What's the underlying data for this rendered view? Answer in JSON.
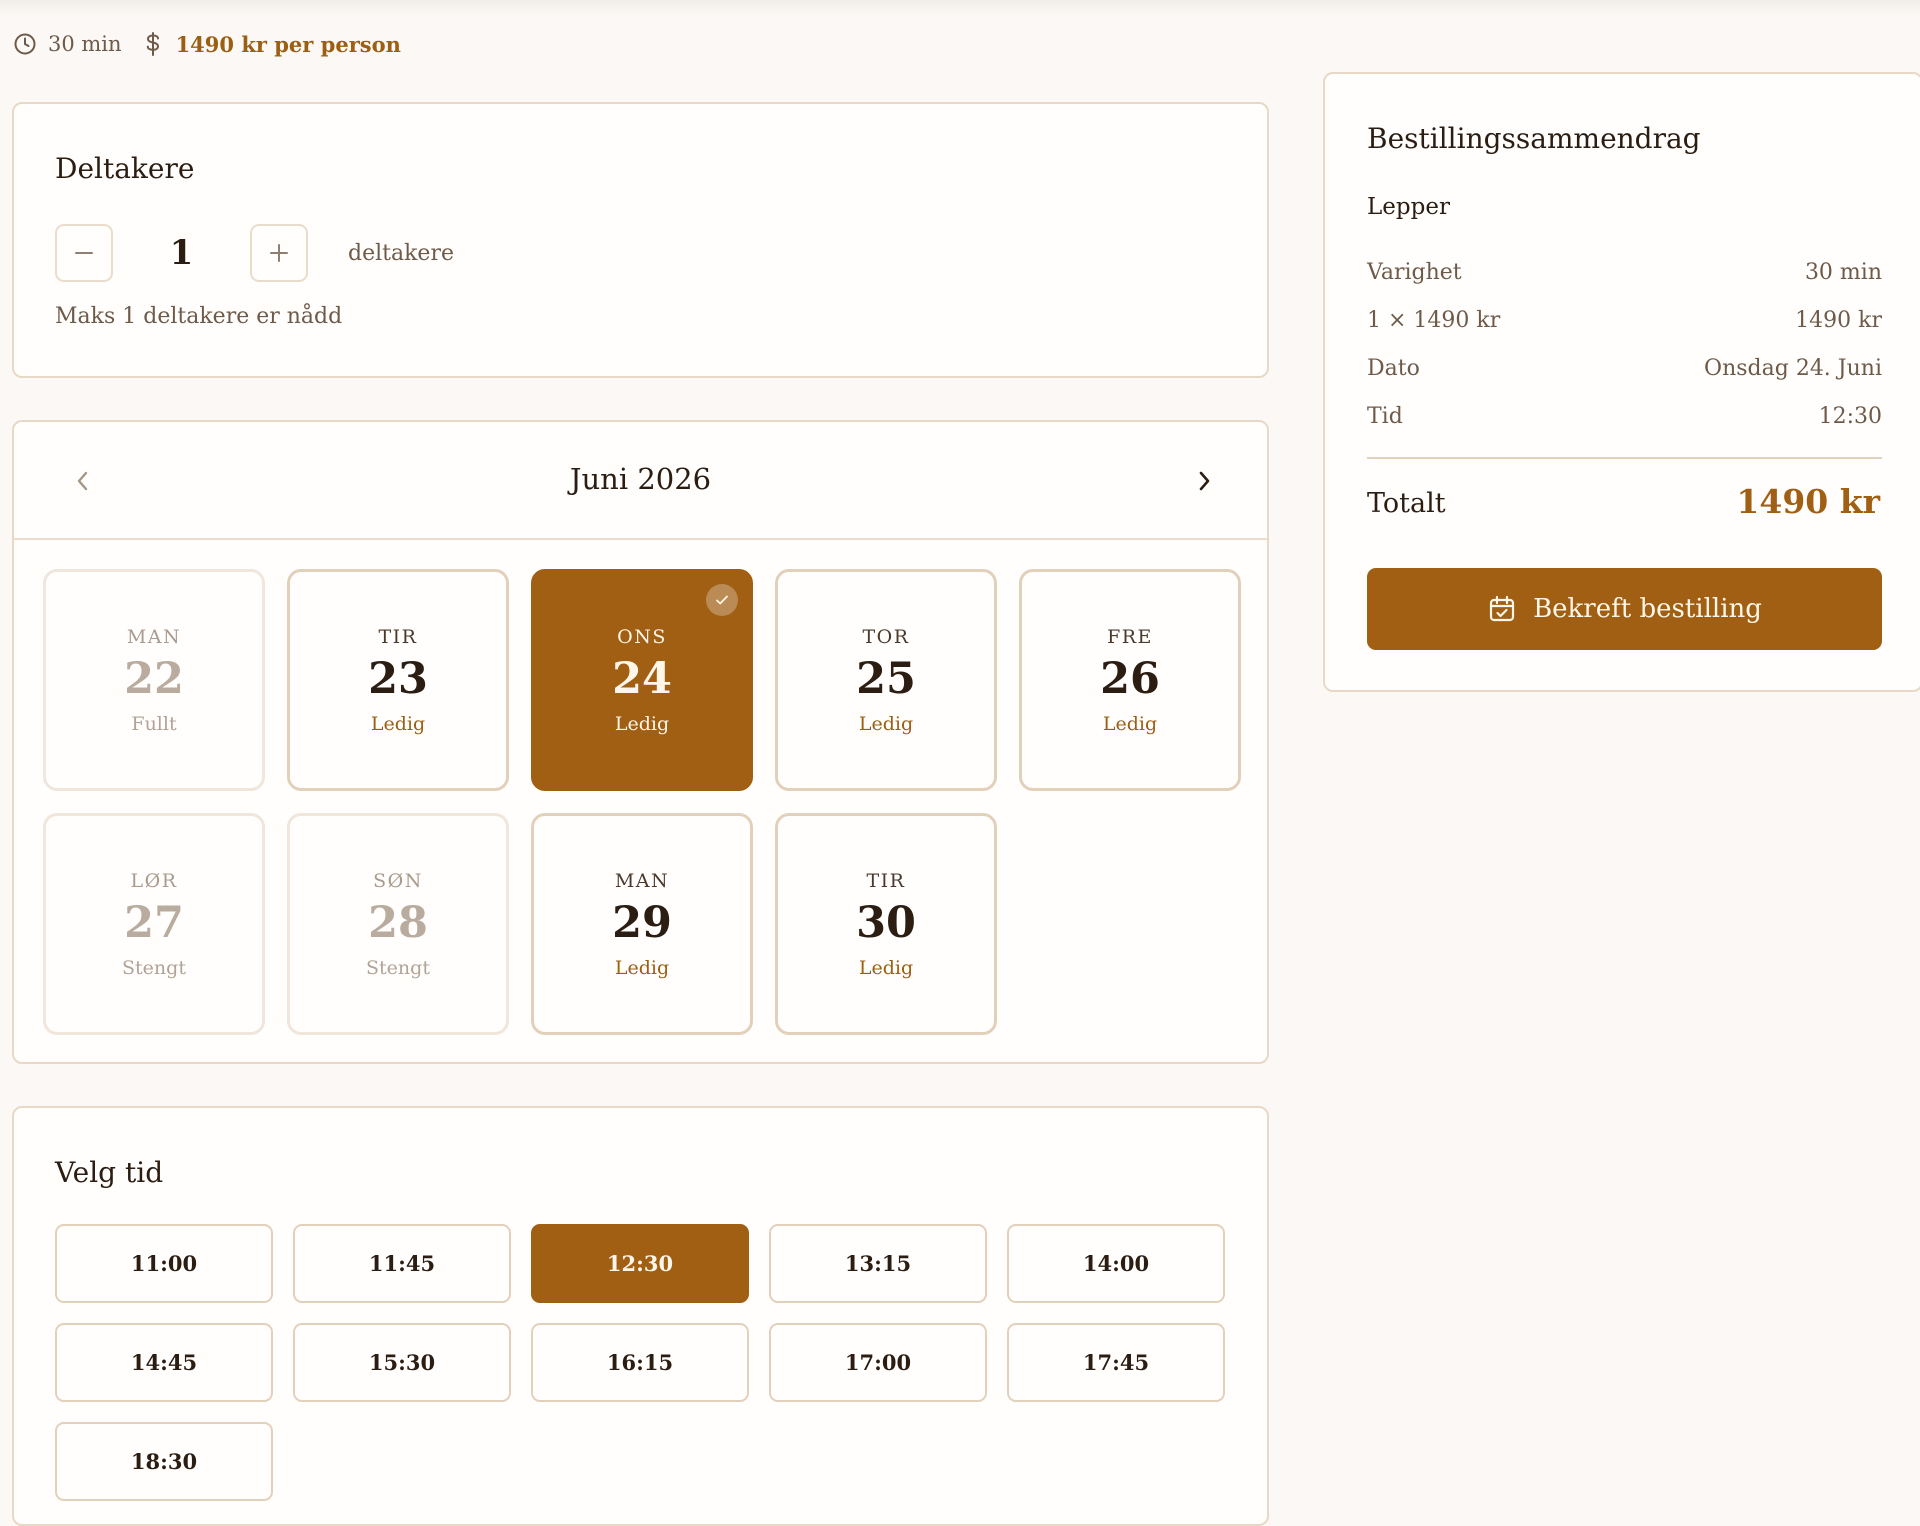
{
  "colors": {
    "accent": "#a05f12",
    "background": "#fcf8f5",
    "card_border": "#e8d8c5"
  },
  "meta": {
    "duration": "30 min",
    "duration_icon": "clock-icon",
    "price": "1490 kr per person",
    "price_icon": "dollar-icon"
  },
  "participants": {
    "title": "Deltakere",
    "decrement_icon": "minus-icon",
    "increment_icon": "plus-icon",
    "value": "1",
    "unit": "deltakere",
    "max_note": "Maks 1 deltakere er nådd"
  },
  "calendar": {
    "month_label": "Juni 2026",
    "prev_icon": "chevron-left-icon",
    "next_icon": "chevron-right-icon",
    "days": [
      {
        "dow": "MAN",
        "num": "22",
        "status": "Fullt",
        "state": "disabled"
      },
      {
        "dow": "TIR",
        "num": "23",
        "status": "Ledig",
        "state": "available"
      },
      {
        "dow": "ONS",
        "num": "24",
        "status": "Ledig",
        "state": "selected"
      },
      {
        "dow": "TOR",
        "num": "25",
        "status": "Ledig",
        "state": "available"
      },
      {
        "dow": "FRE",
        "num": "26",
        "status": "Ledig",
        "state": "available"
      },
      {
        "dow": "LØR",
        "num": "27",
        "status": "Stengt",
        "state": "disabled"
      },
      {
        "dow": "SØN",
        "num": "28",
        "status": "Stengt",
        "state": "disabled"
      },
      {
        "dow": "MAN",
        "num": "29",
        "status": "Ledig",
        "state": "available"
      },
      {
        "dow": "TIR",
        "num": "30",
        "status": "Ledig",
        "state": "available"
      }
    ]
  },
  "times": {
    "title": "Velg tid",
    "slots": [
      {
        "label": "11:00",
        "selected": false
      },
      {
        "label": "11:45",
        "selected": false
      },
      {
        "label": "12:30",
        "selected": true
      },
      {
        "label": "13:15",
        "selected": false
      },
      {
        "label": "14:00",
        "selected": false
      },
      {
        "label": "14:45",
        "selected": false
      },
      {
        "label": "15:30",
        "selected": false
      },
      {
        "label": "16:15",
        "selected": false
      },
      {
        "label": "17:00",
        "selected": false
      },
      {
        "label": "17:45",
        "selected": false
      },
      {
        "label": "18:30",
        "selected": false
      }
    ]
  },
  "summary": {
    "title": "Bestillingssammendrag",
    "service": "Lepper",
    "rows": [
      {
        "label": "Varighet",
        "value": "30 min"
      },
      {
        "label": "1 × 1490 kr",
        "value": "1490 kr"
      },
      {
        "label": "Dato",
        "value": "Onsdag 24. Juni"
      },
      {
        "label": "Tid",
        "value": "12:30"
      }
    ],
    "total_label": "Totalt",
    "total_value": "1490 kr",
    "confirm_label": "Bekreft bestilling",
    "confirm_icon": "calendar-check-icon"
  }
}
